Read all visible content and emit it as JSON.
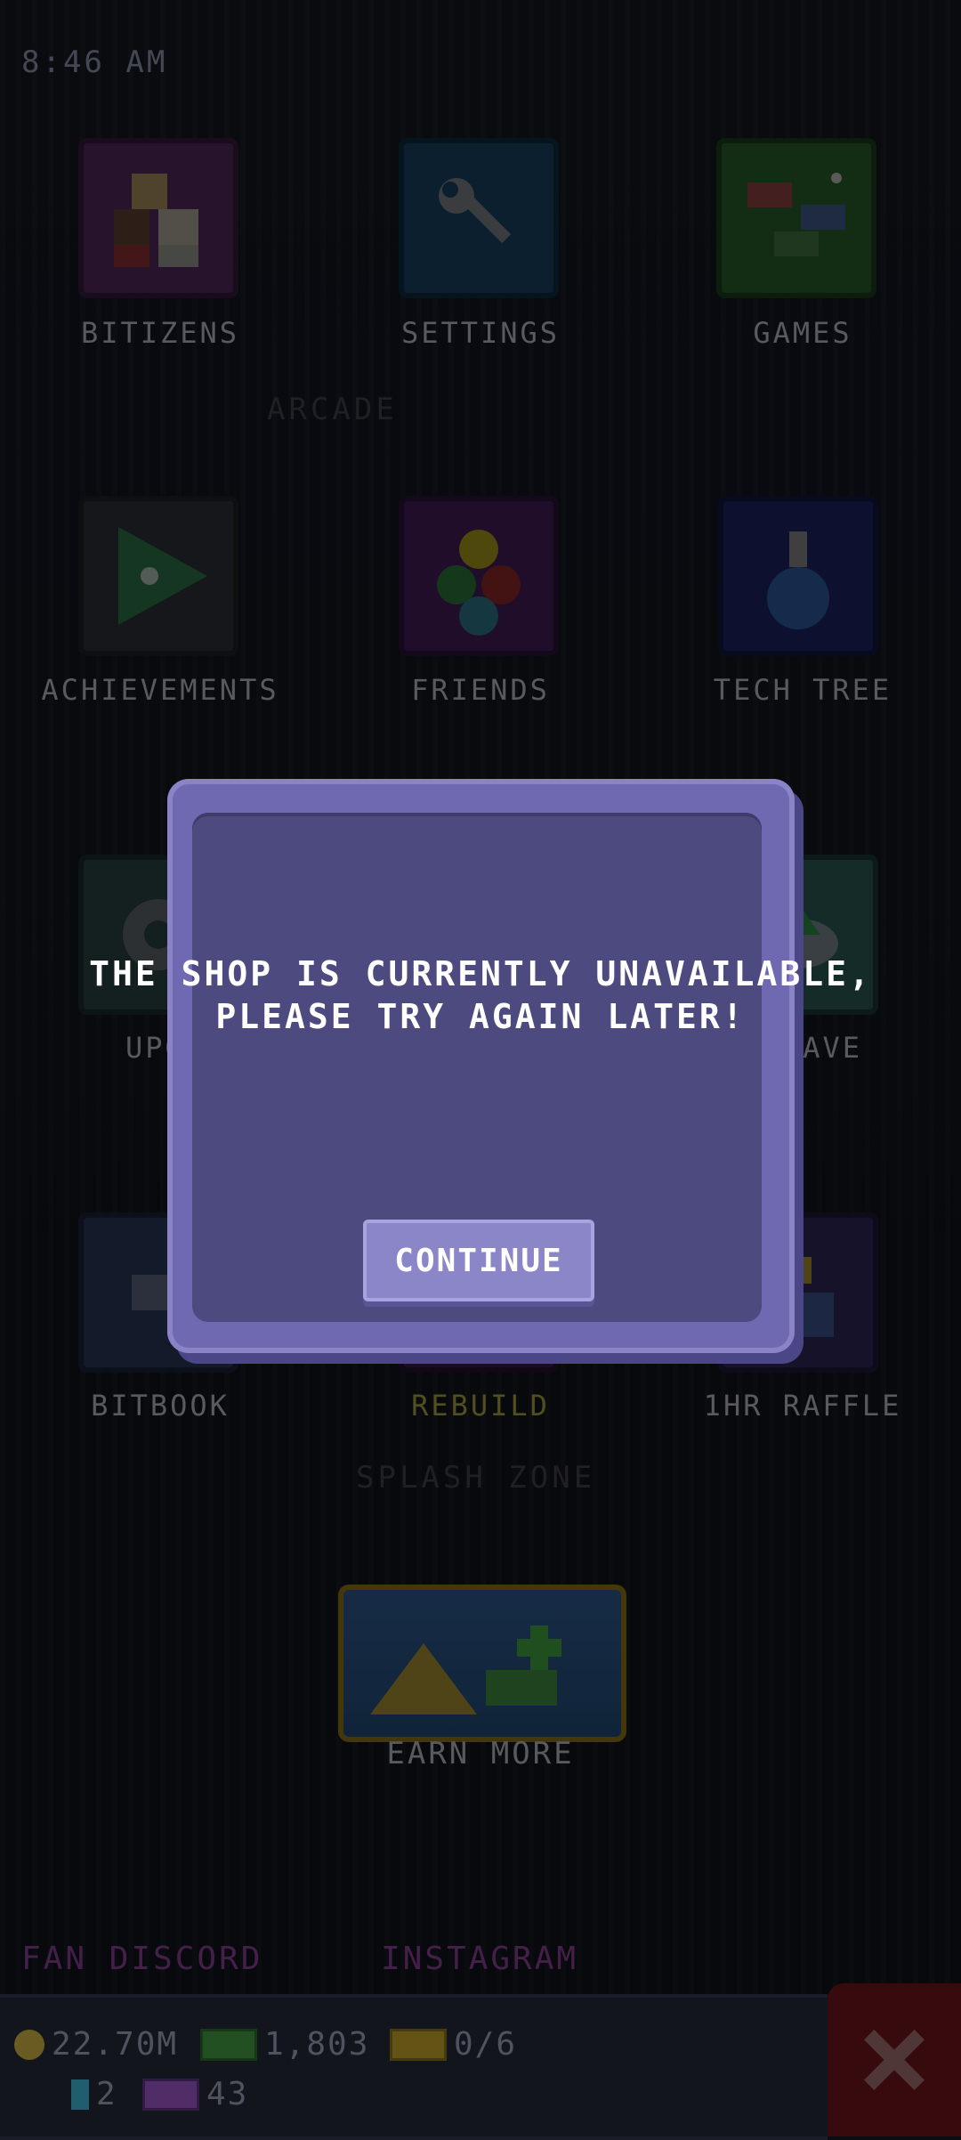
{
  "status_bar": {
    "time": "8:46 AM"
  },
  "menu": {
    "bitizens": "BITIZENS",
    "settings": "SETTINGS",
    "games": "GAMES",
    "achievements": "ACHIEVEMENTS",
    "friends": "FRIENDS",
    "tech_tree": "TECH TREE",
    "upgrades_partial": "UPGR",
    "cloud_save_partial": "SAVE",
    "bitbook": "BITBOOK",
    "rebuild": "REBUILD",
    "raffle": "1HR RAFFLE",
    "earn_more": "EARN MORE"
  },
  "social": {
    "discord": "FAN DISCORD",
    "instagram": "INSTAGRAM"
  },
  "resources": {
    "coins": "22.70M",
    "bux": "1,803",
    "tickets": "0/6",
    "gems": "2",
    "vip": "43"
  },
  "dialog": {
    "message": "THE SHOP IS CURRENTLY UNAVAILABLE, PLEASE TRY AGAIN LATER!",
    "button": "CONTINUE"
  },
  "colors": {
    "modal_outer": "#6f69b2",
    "modal_inner": "#4d4a7f",
    "button": "#8b86c8"
  }
}
